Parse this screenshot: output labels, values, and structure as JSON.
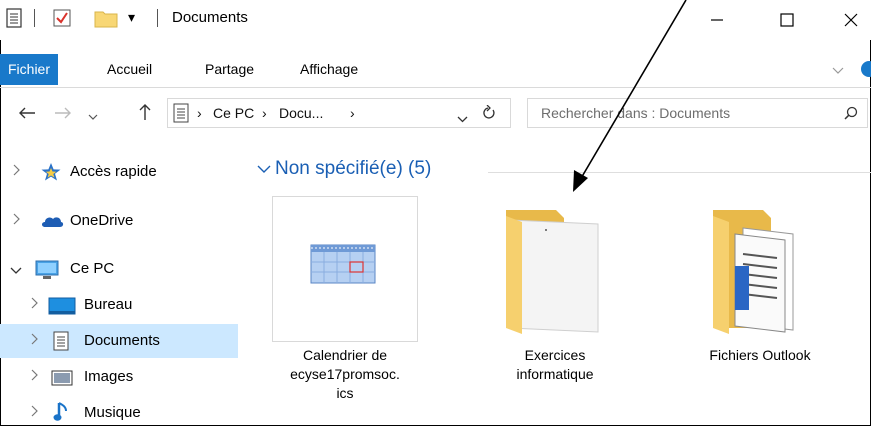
{
  "window": {
    "title": "Documents",
    "qat_dropdown_glyph": "▾"
  },
  "ribbon": {
    "tabs": [
      {
        "label": "Fichier",
        "active": true
      },
      {
        "label": "Accueil",
        "active": false
      },
      {
        "label": "Partage",
        "active": false
      },
      {
        "label": "Affichage",
        "active": false
      }
    ],
    "accent": "#1979ca"
  },
  "address": {
    "crumbs": [
      "Ce PC",
      "Docu..."
    ],
    "separator": "›"
  },
  "search": {
    "placeholder": "Rechercher dans : Documents"
  },
  "nav_pane": {
    "items": [
      {
        "label": "Accès rapide",
        "icon": "star-icon"
      },
      {
        "label": "OneDrive",
        "icon": "cloud-icon"
      },
      {
        "label": "Ce PC",
        "icon": "computer-icon",
        "expanded": true
      },
      {
        "label": "Bureau",
        "icon": "desktop-icon"
      },
      {
        "label": "Documents",
        "icon": "document-icon",
        "selected": true
      },
      {
        "label": "Images",
        "icon": "images-icon"
      },
      {
        "label": "Musique",
        "icon": "music-icon"
      }
    ]
  },
  "content": {
    "group_header": "Non spécifié(e) (5)",
    "items": [
      {
        "label_lines": [
          "Calendrier de",
          "ecyse17promsoc.",
          "ics"
        ],
        "icon": "calendar-file-icon",
        "selected": true
      },
      {
        "label_lines": [
          "Exercices",
          "informatique"
        ],
        "icon": "folder-icon"
      },
      {
        "label_lines": [
          "Fichiers Outlook"
        ],
        "icon": "folder-documents-icon"
      }
    ]
  }
}
